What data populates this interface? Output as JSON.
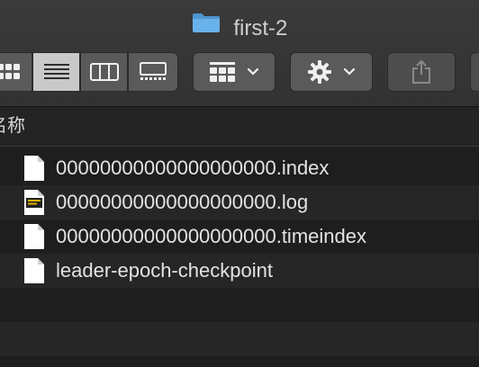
{
  "window": {
    "title": "first-2",
    "title_icon": "folder-icon"
  },
  "toolbar": {
    "view_modes": [
      {
        "name": "icon-view",
        "icon": "grid-icon",
        "active": false
      },
      {
        "name": "list-view",
        "icon": "list-icon",
        "active": true
      },
      {
        "name": "column-view",
        "icon": "columns-icon",
        "active": false
      },
      {
        "name": "gallery-view",
        "icon": "gallery-icon",
        "active": false
      }
    ],
    "group_button": {
      "icon": "group-grid-icon",
      "dropdown_icon": "chevron-down-icon"
    },
    "action_button": {
      "icon": "gear-icon",
      "dropdown_icon": "chevron-down-icon"
    },
    "share_button": {
      "icon": "share-icon",
      "enabled": false
    }
  },
  "column_header": {
    "name_label": "名称"
  },
  "files": [
    {
      "name": "00000000000000000000.index",
      "icon": "document-icon"
    },
    {
      "name": "00000000000000000000.log",
      "icon": "log-document-icon"
    },
    {
      "name": "00000000000000000000.timeindex",
      "icon": "document-icon"
    },
    {
      "name": "leader-epoch-checkpoint",
      "icon": "document-icon"
    }
  ],
  "colors": {
    "background": "#1e1e1e",
    "toolbar": "#3a3a3a",
    "button": "#5a5a5a",
    "active_segment": "#c9c9c9",
    "folder_blue": "#62a9e2",
    "text": "#e3e3e3"
  }
}
